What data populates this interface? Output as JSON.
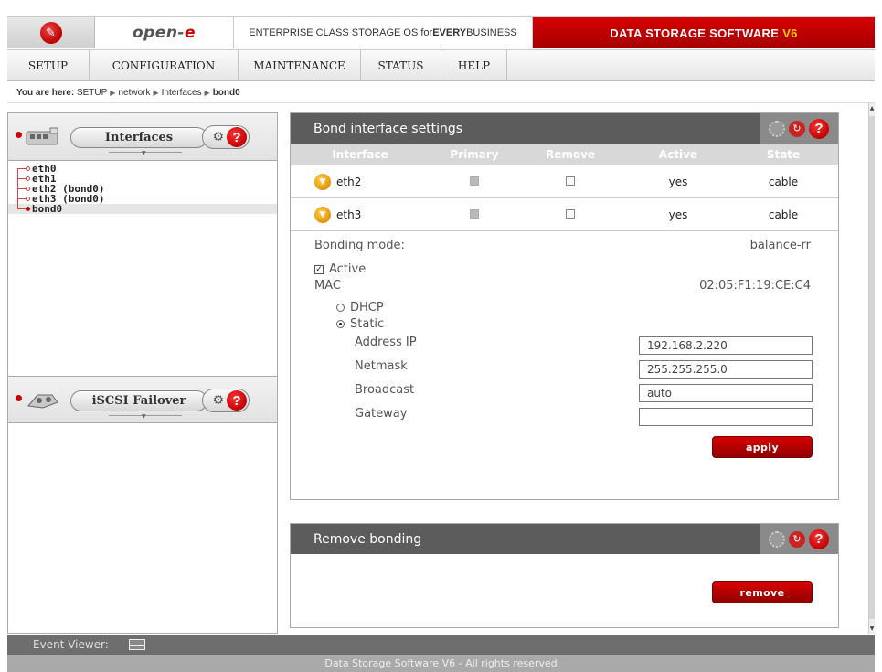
{
  "banner": {
    "brand_prefix": "open-",
    "brand_suffix": "e",
    "tagline_part1": "ENTERPRISE CLASS STORAGE OS for ",
    "tagline_bold": "EVERY",
    "tagline_part2": " BUSINESS",
    "product": "DATA STORAGE SOFTWARE",
    "version": "V6"
  },
  "nav": {
    "items": [
      {
        "label": "SETUP"
      },
      {
        "label": "CONFIGURATION"
      },
      {
        "label": "MAINTENANCE"
      },
      {
        "label": "STATUS"
      },
      {
        "label": "HELP"
      }
    ]
  },
  "breadcrumb": {
    "prefix": "You are here:",
    "items": [
      "SETUP",
      "network",
      "Interfaces"
    ],
    "current": "bond0"
  },
  "left": {
    "section1_title": "Interfaces",
    "tree": [
      {
        "label": "eth0"
      },
      {
        "label": "eth1"
      },
      {
        "label": "eth2 (bond0)"
      },
      {
        "label": "eth3 (bond0)"
      },
      {
        "label": "bond0"
      }
    ],
    "section2_title": "iSCSI Failover",
    "help_glyph": "?"
  },
  "bond_settings": {
    "title": "Bond interface settings",
    "columns": [
      "Interface",
      "Primary",
      "Remove",
      "Active",
      "State"
    ],
    "rows": [
      {
        "interface": "eth2",
        "active": "yes",
        "state": "cable"
      },
      {
        "interface": "eth3",
        "active": "yes",
        "state": "cable"
      }
    ],
    "bonding_mode_label": "Bonding mode:",
    "bonding_mode_value": "balance-rr",
    "active_label": "Active",
    "mac_label": "MAC",
    "mac_value": "02:05:F1:19:CE:C4",
    "dhcp_label": "DHCP",
    "static_label": "Static",
    "address_ip_label": "Address IP",
    "address_ip_value": "192.168.2.220",
    "netmask_label": "Netmask",
    "netmask_value": "255.255.255.0",
    "broadcast_label": "Broadcast",
    "broadcast_value": "auto",
    "gateway_label": "Gateway",
    "gateway_value": "",
    "apply_label": "apply"
  },
  "remove_bonding": {
    "title": "Remove bonding",
    "remove_label": "remove"
  },
  "footer": {
    "event_viewer": "Event Viewer:",
    "copyright": "Data Storage Software V6 - All rights reserved"
  },
  "colors": {
    "accent_red": "#c00000",
    "header_gray": "#5c5c5c",
    "version_yellow": "#ffcc00"
  }
}
